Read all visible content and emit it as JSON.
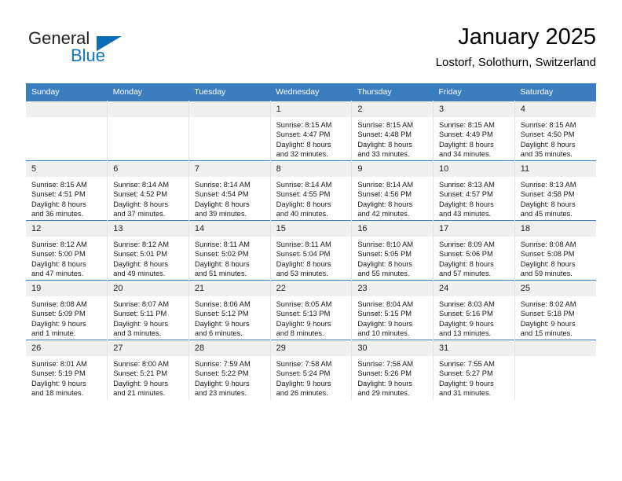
{
  "brand": {
    "name_top": "General",
    "name_bottom": "Blue",
    "accent_color": "#0e76bc",
    "triangle_color": "#0b6cb5"
  },
  "header": {
    "title": "January 2025",
    "subtitle": "Lostorf, Solothurn, Switzerland",
    "header_bg": "#3b7ebf",
    "daynum_bg": "#f0f0f0"
  },
  "weekdays": [
    "Sunday",
    "Monday",
    "Tuesday",
    "Wednesday",
    "Thursday",
    "Friday",
    "Saturday"
  ],
  "weeks": [
    [
      {
        "day": "",
        "lines": []
      },
      {
        "day": "",
        "lines": []
      },
      {
        "day": "",
        "lines": []
      },
      {
        "day": "1",
        "lines": [
          "Sunrise: 8:15 AM",
          "Sunset: 4:47 PM",
          "Daylight: 8 hours",
          "and 32 minutes."
        ]
      },
      {
        "day": "2",
        "lines": [
          "Sunrise: 8:15 AM",
          "Sunset: 4:48 PM",
          "Daylight: 8 hours",
          "and 33 minutes."
        ]
      },
      {
        "day": "3",
        "lines": [
          "Sunrise: 8:15 AM",
          "Sunset: 4:49 PM",
          "Daylight: 8 hours",
          "and 34 minutes."
        ]
      },
      {
        "day": "4",
        "lines": [
          "Sunrise: 8:15 AM",
          "Sunset: 4:50 PM",
          "Daylight: 8 hours",
          "and 35 minutes."
        ]
      }
    ],
    [
      {
        "day": "5",
        "lines": [
          "Sunrise: 8:15 AM",
          "Sunset: 4:51 PM",
          "Daylight: 8 hours",
          "and 36 minutes."
        ]
      },
      {
        "day": "6",
        "lines": [
          "Sunrise: 8:14 AM",
          "Sunset: 4:52 PM",
          "Daylight: 8 hours",
          "and 37 minutes."
        ]
      },
      {
        "day": "7",
        "lines": [
          "Sunrise: 8:14 AM",
          "Sunset: 4:54 PM",
          "Daylight: 8 hours",
          "and 39 minutes."
        ]
      },
      {
        "day": "8",
        "lines": [
          "Sunrise: 8:14 AM",
          "Sunset: 4:55 PM",
          "Daylight: 8 hours",
          "and 40 minutes."
        ]
      },
      {
        "day": "9",
        "lines": [
          "Sunrise: 8:14 AM",
          "Sunset: 4:56 PM",
          "Daylight: 8 hours",
          "and 42 minutes."
        ]
      },
      {
        "day": "10",
        "lines": [
          "Sunrise: 8:13 AM",
          "Sunset: 4:57 PM",
          "Daylight: 8 hours",
          "and 43 minutes."
        ]
      },
      {
        "day": "11",
        "lines": [
          "Sunrise: 8:13 AM",
          "Sunset: 4:58 PM",
          "Daylight: 8 hours",
          "and 45 minutes."
        ]
      }
    ],
    [
      {
        "day": "12",
        "lines": [
          "Sunrise: 8:12 AM",
          "Sunset: 5:00 PM",
          "Daylight: 8 hours",
          "and 47 minutes."
        ]
      },
      {
        "day": "13",
        "lines": [
          "Sunrise: 8:12 AM",
          "Sunset: 5:01 PM",
          "Daylight: 8 hours",
          "and 49 minutes."
        ]
      },
      {
        "day": "14",
        "lines": [
          "Sunrise: 8:11 AM",
          "Sunset: 5:02 PM",
          "Daylight: 8 hours",
          "and 51 minutes."
        ]
      },
      {
        "day": "15",
        "lines": [
          "Sunrise: 8:11 AM",
          "Sunset: 5:04 PM",
          "Daylight: 8 hours",
          "and 53 minutes."
        ]
      },
      {
        "day": "16",
        "lines": [
          "Sunrise: 8:10 AM",
          "Sunset: 5:05 PM",
          "Daylight: 8 hours",
          "and 55 minutes."
        ]
      },
      {
        "day": "17",
        "lines": [
          "Sunrise: 8:09 AM",
          "Sunset: 5:06 PM",
          "Daylight: 8 hours",
          "and 57 minutes."
        ]
      },
      {
        "day": "18",
        "lines": [
          "Sunrise: 8:08 AM",
          "Sunset: 5:08 PM",
          "Daylight: 8 hours",
          "and 59 minutes."
        ]
      }
    ],
    [
      {
        "day": "19",
        "lines": [
          "Sunrise: 8:08 AM",
          "Sunset: 5:09 PM",
          "Daylight: 9 hours",
          "and 1 minute."
        ]
      },
      {
        "day": "20",
        "lines": [
          "Sunrise: 8:07 AM",
          "Sunset: 5:11 PM",
          "Daylight: 9 hours",
          "and 3 minutes."
        ]
      },
      {
        "day": "21",
        "lines": [
          "Sunrise: 8:06 AM",
          "Sunset: 5:12 PM",
          "Daylight: 9 hours",
          "and 6 minutes."
        ]
      },
      {
        "day": "22",
        "lines": [
          "Sunrise: 8:05 AM",
          "Sunset: 5:13 PM",
          "Daylight: 9 hours",
          "and 8 minutes."
        ]
      },
      {
        "day": "23",
        "lines": [
          "Sunrise: 8:04 AM",
          "Sunset: 5:15 PM",
          "Daylight: 9 hours",
          "and 10 minutes."
        ]
      },
      {
        "day": "24",
        "lines": [
          "Sunrise: 8:03 AM",
          "Sunset: 5:16 PM",
          "Daylight: 9 hours",
          "and 13 minutes."
        ]
      },
      {
        "day": "25",
        "lines": [
          "Sunrise: 8:02 AM",
          "Sunset: 5:18 PM",
          "Daylight: 9 hours",
          "and 15 minutes."
        ]
      }
    ],
    [
      {
        "day": "26",
        "lines": [
          "Sunrise: 8:01 AM",
          "Sunset: 5:19 PM",
          "Daylight: 9 hours",
          "and 18 minutes."
        ]
      },
      {
        "day": "27",
        "lines": [
          "Sunrise: 8:00 AM",
          "Sunset: 5:21 PM",
          "Daylight: 9 hours",
          "and 21 minutes."
        ]
      },
      {
        "day": "28",
        "lines": [
          "Sunrise: 7:59 AM",
          "Sunset: 5:22 PM",
          "Daylight: 9 hours",
          "and 23 minutes."
        ]
      },
      {
        "day": "29",
        "lines": [
          "Sunrise: 7:58 AM",
          "Sunset: 5:24 PM",
          "Daylight: 9 hours",
          "and 26 minutes."
        ]
      },
      {
        "day": "30",
        "lines": [
          "Sunrise: 7:56 AM",
          "Sunset: 5:26 PM",
          "Daylight: 9 hours",
          "and 29 minutes."
        ]
      },
      {
        "day": "31",
        "lines": [
          "Sunrise: 7:55 AM",
          "Sunset: 5:27 PM",
          "Daylight: 9 hours",
          "and 31 minutes."
        ]
      },
      {
        "day": "",
        "lines": []
      }
    ]
  ]
}
